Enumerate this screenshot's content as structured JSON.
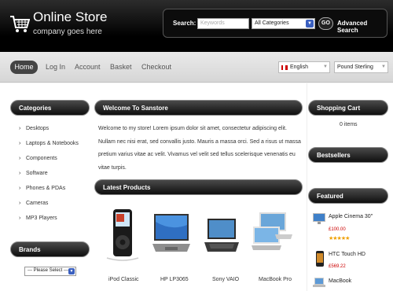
{
  "header": {
    "store_name": "Online Store",
    "tagline": "company goes here",
    "search_label": "Search:",
    "search_placeholder": "Keywords",
    "category_value": "All Categories",
    "go_label": "GO",
    "advanced_label": "Advanced Search"
  },
  "nav": {
    "items": [
      "Home",
      "Log In",
      "Account",
      "Basket",
      "Checkout"
    ],
    "language": "English",
    "currency": "Pound Sterling"
  },
  "left": {
    "categories_title": "Categories",
    "categories": [
      "Desktops",
      "Laptops & Notebooks",
      "Components",
      "Software",
      "Phones & PDAs",
      "Cameras",
      "MP3 Players"
    ],
    "brands_title": "Brands",
    "brand_select": "--- Please Select ---"
  },
  "center": {
    "welcome_title": "Welcome To Sanstore",
    "welcome_text": "Welcome to my store! Lorem ipsum dolor sit amet, consectetur adipiscing elit. Nullam nec nisi erat, sed convallis justo. Mauris a massa orci. Sed a risus ut massa pretium varius vitae ac velit. Vivamus vel velit sed tellus scelerisque venenatis eu vitae turpis.",
    "latest_title": "Latest Products",
    "products": [
      "iPod Classic",
      "HP LP3065",
      "Sony VAIO",
      "MacBook Pro"
    ]
  },
  "right": {
    "cart_title": "Shopping Cart",
    "cart_items": "0 items",
    "bestsellers_title": "Bestsellers",
    "featured_title": "Featured",
    "featured": [
      {
        "name": "Apple Cinema 30\"",
        "price": "£100.00"
      },
      {
        "name": "HTC Touch HD",
        "price": "£569.22"
      },
      {
        "name": "MacBook",
        "price": ""
      }
    ],
    "rating_stars": 5
  },
  "colors": {
    "header_bg": "#000000",
    "pill_bg": "#1a1a1a",
    "select_arrow": "#3a5fbf",
    "price": "#cc0000"
  }
}
